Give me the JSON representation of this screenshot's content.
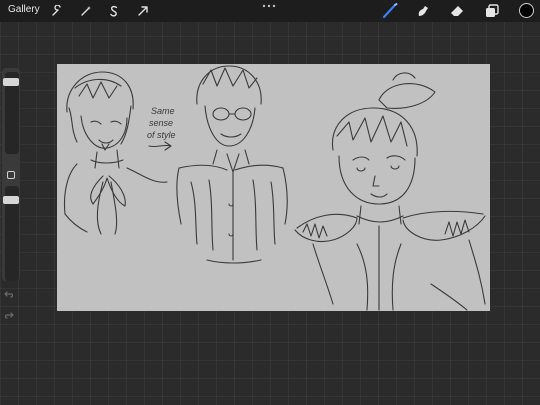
{
  "toolbar": {
    "gallery_label": "Gallery",
    "left_tools": [
      "wrench-icon",
      "magic-wand-icon",
      "selection-icon",
      "transform-arrow-icon"
    ],
    "right_tools": [
      "brush-icon",
      "smudge-icon",
      "eraser-icon",
      "layers-icon"
    ],
    "active_tool": "brush-icon",
    "active_color": "#000000",
    "accent": "#3f7ff5"
  },
  "sidebar": {
    "size_slider_level": 0.95,
    "opacity_slider_level": 0.75
  },
  "canvas": {
    "background": "#c1c1c1",
    "annotation_lines": [
      "Same",
      "sense",
      "of style"
    ]
  }
}
